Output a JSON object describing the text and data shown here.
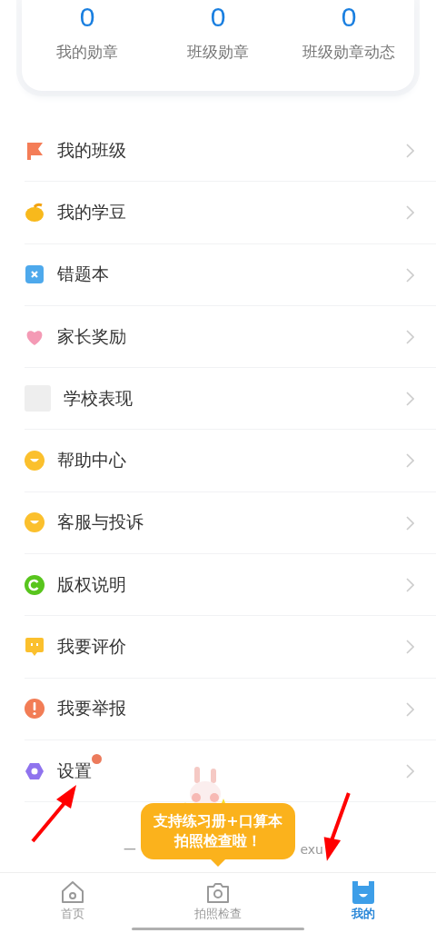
{
  "stats": [
    {
      "value": "0",
      "label": "我的勋章"
    },
    {
      "value": "0",
      "label": "班级勋章"
    },
    {
      "value": "0",
      "label": "班级勋章动态"
    }
  ],
  "menu": [
    {
      "kind": "flag",
      "label": "我的班级",
      "badge": false,
      "pointed": false
    },
    {
      "kind": "bean",
      "label": "我的学豆",
      "badge": false,
      "pointed": false
    },
    {
      "kind": "cross",
      "label": "错题本",
      "badge": false,
      "pointed": false
    },
    {
      "kind": "heart",
      "label": "家长奖励",
      "badge": false,
      "pointed": false
    },
    {
      "kind": "blank",
      "label": "学校表现",
      "badge": false,
      "pointed": false
    },
    {
      "kind": "smile",
      "label": "帮助中心",
      "badge": false,
      "pointed": false
    },
    {
      "kind": "smile",
      "label": "客服与投诉",
      "badge": false,
      "pointed": false
    },
    {
      "kind": "copyright",
      "label": "版权说明",
      "badge": false,
      "pointed": false
    },
    {
      "kind": "chat",
      "label": "我要评价",
      "badge": false,
      "pointed": false
    },
    {
      "kind": "alert",
      "label": "我要举报",
      "badge": false,
      "pointed": false
    },
    {
      "kind": "hexagon",
      "label": "设置",
      "badge": true,
      "pointed": true
    }
  ],
  "footer": {
    "left": "一",
    "right": "exu"
  },
  "tooltip": {
    "lines": [
      "支持练习册+口算本",
      "拍照检查啦！"
    ]
  },
  "tabs": [
    {
      "kind": "home",
      "label": "首页",
      "selected": false,
      "pointed": false
    },
    {
      "kind": "camera",
      "label": "拍照检查",
      "selected": false,
      "pointed": false
    },
    {
      "kind": "mine",
      "label": "我的",
      "selected": true,
      "pointed": true
    }
  ]
}
